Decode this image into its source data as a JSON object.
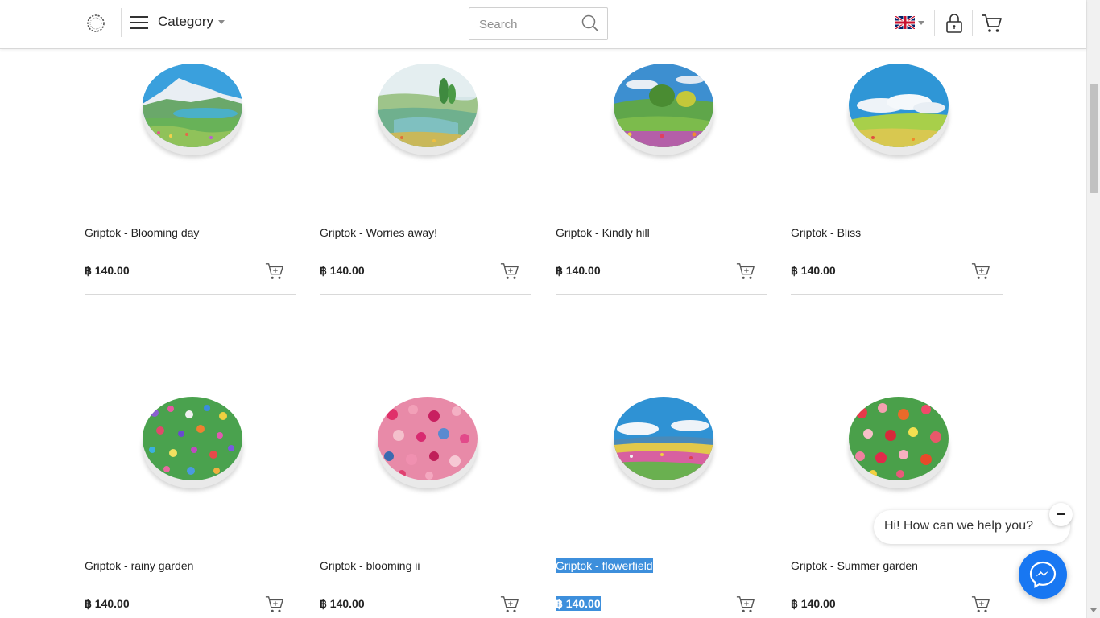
{
  "header": {
    "category_label": "Category",
    "search_placeholder": "Search",
    "language": "English (UK flag)"
  },
  "products": [
    {
      "name": "Griptok - Blooming day",
      "price": "฿ 140.00",
      "image": "mountain-lake-painting",
      "highlighted": false
    },
    {
      "name": "Griptok - Worries away!",
      "price": "฿ 140.00",
      "image": "meadow-trees-painting",
      "highlighted": false
    },
    {
      "name": "Griptok - Kindly hill",
      "price": "฿ 140.00",
      "image": "green-hill-painting",
      "highlighted": false
    },
    {
      "name": "Griptok - Bliss",
      "price": "฿ 140.00",
      "image": "sky-clouds-field-painting",
      "highlighted": false
    },
    {
      "name": "Griptok - rainy garden",
      "price": "฿ 140.00",
      "image": "colorful-garden-painting",
      "highlighted": false
    },
    {
      "name": "Griptok - blooming ii",
      "price": "฿ 140.00",
      "image": "pink-flowers-painting",
      "highlighted": false
    },
    {
      "name": "Griptok - flowerfield",
      "price": "฿ 140.00",
      "image": "flower-field-sky-painting",
      "highlighted": true
    },
    {
      "name": "Griptok - Summer garden",
      "price": "฿ 140.00",
      "image": "red-flowers-painting",
      "highlighted": false
    }
  ],
  "chat": {
    "greeting": "Hi! How can we help you?"
  },
  "colors": {
    "accent_blue": "#1877f2",
    "selection": "#3d8fdc",
    "divider": "#d9d9d9"
  }
}
